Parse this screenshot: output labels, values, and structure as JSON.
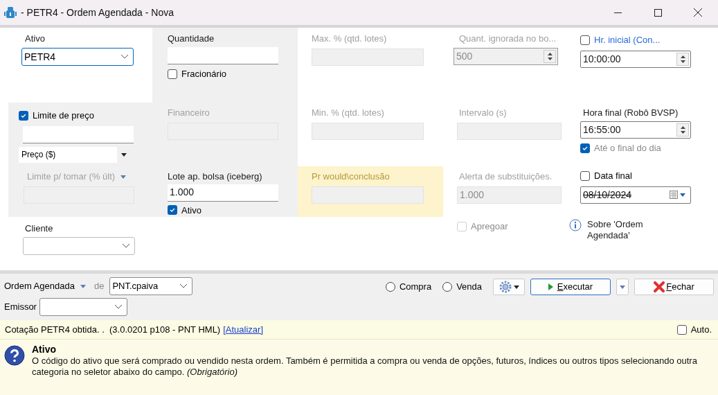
{
  "window": {
    "title": "- PETR4 - Ordem Agendada - Nova"
  },
  "fields": {
    "ativo": {
      "label": "Ativo",
      "value": "PETR4"
    },
    "quantidade": {
      "label": "Quantidade",
      "fracionario": {
        "label": "Fracionário",
        "checked": false
      }
    },
    "max_pct": {
      "label": "Max. % (qtd. lotes)",
      "disabled": true
    },
    "quant_ignorada": {
      "label": "Quant. ignorada no bo...",
      "value": "500",
      "disabled": true
    },
    "hr_inicial": {
      "label": "Hr. inicial (Con...",
      "checked": false,
      "value": "10:00:00"
    },
    "limite_preco": {
      "label": "Limite de preço",
      "checked": true,
      "unit": "Preço ($)"
    },
    "financeiro": {
      "label": "Financeiro",
      "disabled": true
    },
    "min_pct": {
      "label": "Min. % (qtd. lotes)",
      "disabled": true
    },
    "intervalo": {
      "label": "Intervalo (s)",
      "disabled": true
    },
    "hora_final": {
      "label": "Hora final (Robô BVSP)",
      "value": "16:55:00",
      "ate_final": {
        "label": "Até o final do dia",
        "checked": true
      }
    },
    "limite_tomar": {
      "label": "Limite p/ tomar (% últ)",
      "disabled": true
    },
    "lote": {
      "label": "Lote ap. bolsa (iceberg)",
      "value": "1.000",
      "ativo": {
        "label": "Ativo",
        "checked": true
      }
    },
    "pr_would": {
      "label": "Pr would\\conclusão",
      "disabled": true
    },
    "alerta": {
      "label": "Alerta de substituições.",
      "value": "1.000",
      "disabled": true
    },
    "data_final": {
      "label": "Data final",
      "checked": false,
      "value": "08/10/2024"
    },
    "cliente": {
      "label": "Cliente"
    },
    "apregoar": {
      "label": "Apregoar",
      "checked": false,
      "disabled": true
    },
    "sobre": {
      "label": "Sobre 'Ordem Agendada'"
    }
  },
  "toolbar": {
    "order_type": "Ordem Agendada",
    "de": "de",
    "account": "PNT.cpaiva",
    "emissor": "Emissor",
    "side": [
      {
        "label": "Compra",
        "selected": false
      },
      {
        "label": "Venda",
        "selected": false
      }
    ],
    "execute": "Executar",
    "close": "Fechar"
  },
  "status": {
    "text": "Cotação PETR4 obtida. .  (3.0.0201 p108 - PNT HML)",
    "link": "[Atualizar]",
    "auto": {
      "label": "Auto.",
      "checked": false
    }
  },
  "help": {
    "title": "Ativo",
    "text": "O código do ativo que será comprado ou vendido nesta ordem. Também é permitida a compra ou venda de opções, futuros, índices ou outros tipos selecionando outra categoria no seletor abaixo do campo. *(Obrigatório)*"
  }
}
